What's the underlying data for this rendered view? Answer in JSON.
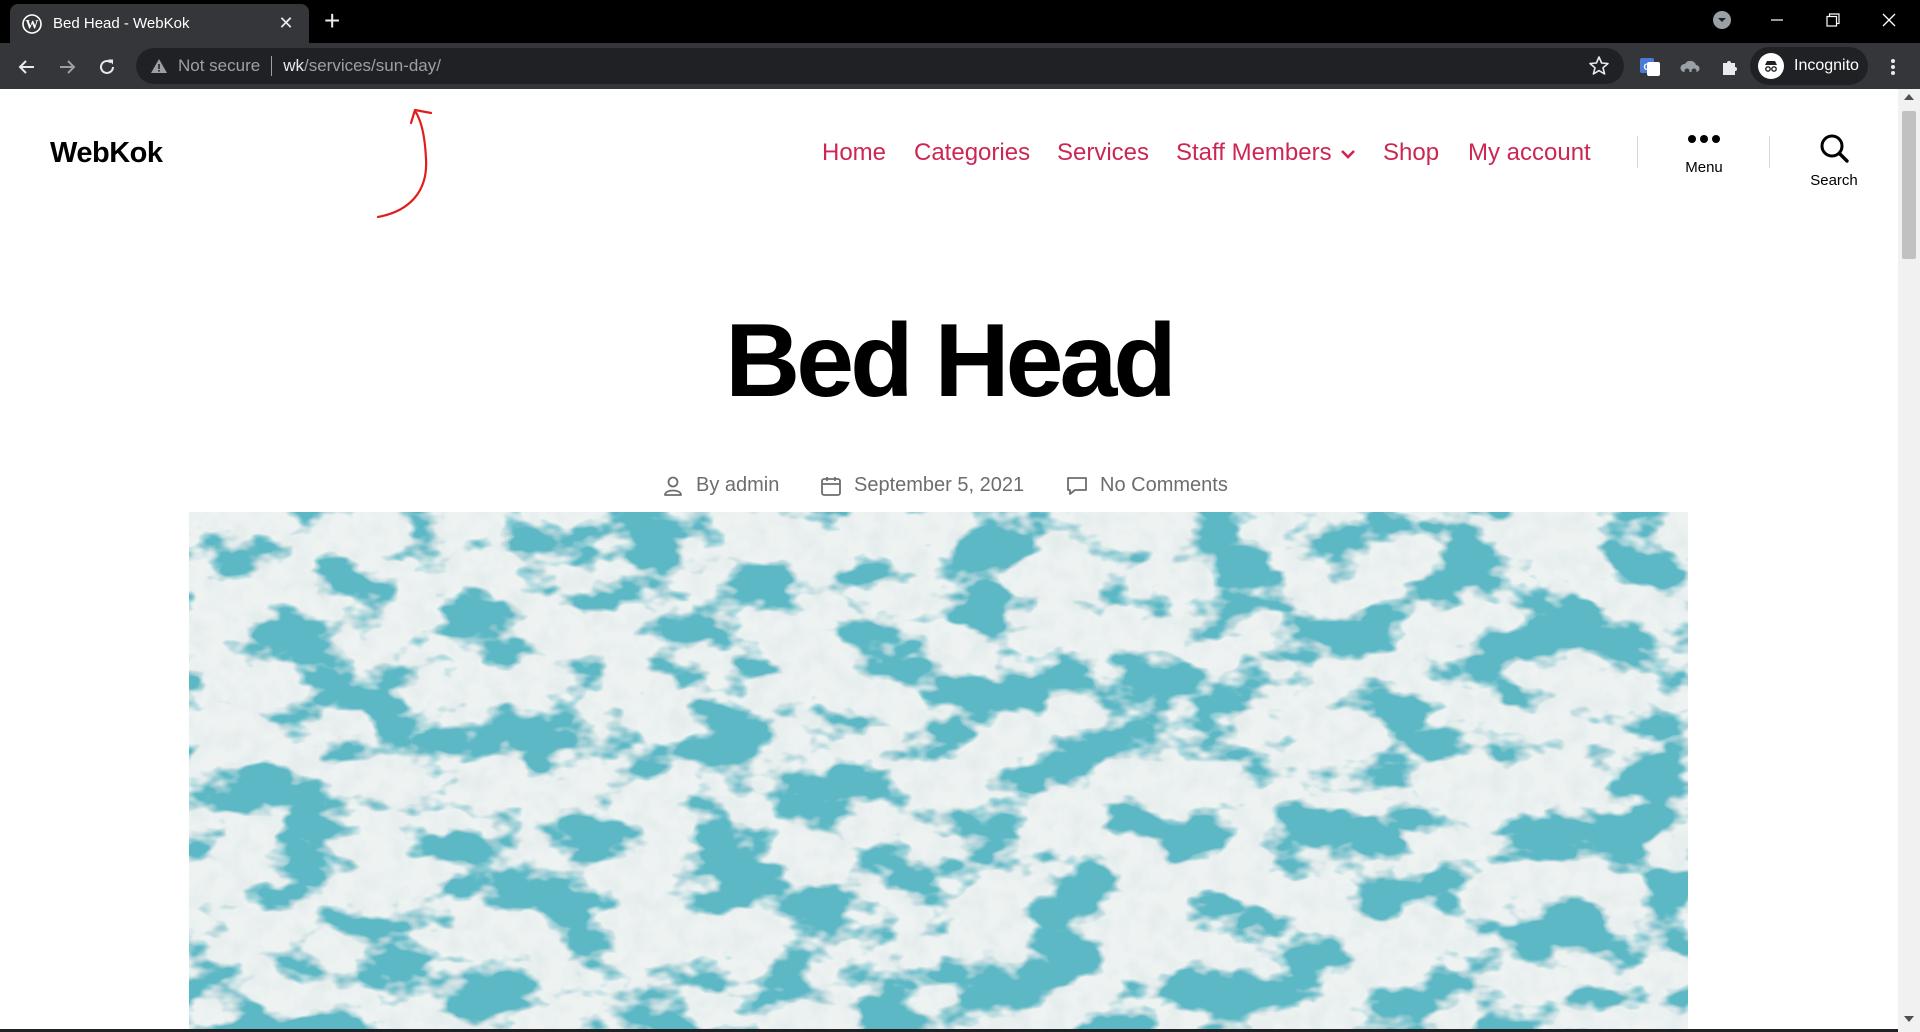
{
  "browser": {
    "tab_title": "Bed Head - WebKok",
    "security_label": "Not secure",
    "url_host": "wk",
    "url_path": "/services/sun-day/",
    "incognito_label": "Incognito"
  },
  "site": {
    "title": "WebKok",
    "nav": [
      {
        "label": "Home"
      },
      {
        "label": "Categories"
      },
      {
        "label": "Services"
      },
      {
        "label": "Staff Members"
      },
      {
        "label": "Shop"
      },
      {
        "label": "My account"
      }
    ],
    "menu_label": "Menu",
    "search_label": "Search"
  },
  "post": {
    "title": "Bed Head",
    "author": "By admin",
    "date": "September 5, 2021",
    "comments": "No Comments"
  },
  "colors": {
    "accent": "#cd2653",
    "annotation": "#e01e1e",
    "meta_text": "#6d6d6d"
  },
  "icons": {
    "favicon": "wordpress-icon",
    "author": "user-icon",
    "date": "calendar-icon",
    "comments": "comment-icon",
    "menu": "dots-icon",
    "search": "search-icon"
  }
}
